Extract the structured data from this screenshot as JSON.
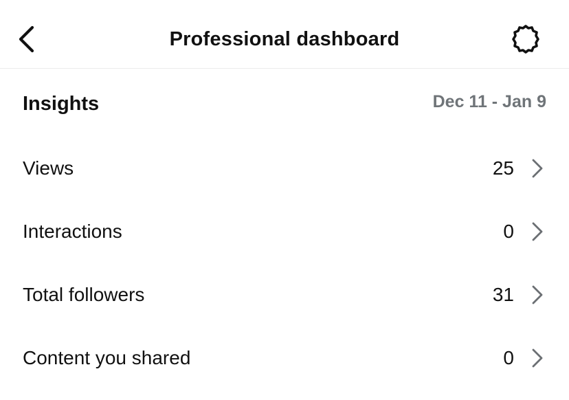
{
  "header": {
    "title": "Professional dashboard",
    "back_icon": "chevron-left-icon",
    "settings_icon": "gear-icon"
  },
  "insights": {
    "title": "Insights",
    "date_range": "Dec 11 - Jan 9",
    "rows": [
      {
        "label": "Views",
        "value": "25"
      },
      {
        "label": "Interactions",
        "value": "0"
      },
      {
        "label": "Total followers",
        "value": "31"
      },
      {
        "label": "Content you shared",
        "value": "0"
      }
    ]
  },
  "colors": {
    "text": "#111111",
    "muted": "#6f7478",
    "chevron": "#6b6f73",
    "divider": "#ececec"
  }
}
